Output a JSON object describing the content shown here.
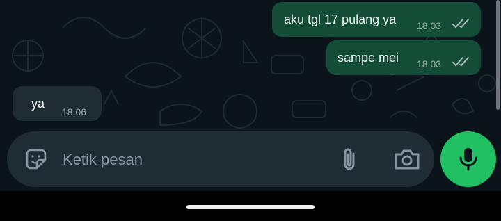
{
  "messages": [
    {
      "direction": "outgoing",
      "text": "aku tgl 17 pulang ya",
      "time": "18.03",
      "status": "read"
    },
    {
      "direction": "outgoing",
      "text": "sampe mei",
      "time": "18.03",
      "status": "read"
    },
    {
      "direction": "incoming",
      "text": "ya",
      "time": "18.06"
    }
  ],
  "composer": {
    "placeholder": "Ketik pesan",
    "value": ""
  },
  "icons": {
    "emoji": "sticker-icon",
    "attach": "paperclip-icon",
    "camera": "camera-icon",
    "mic": "microphone-icon",
    "ticks": "double-check-icon"
  },
  "colors": {
    "background": "#0b141a",
    "outgoing_bubble": "#134d37",
    "incoming_bubble": "#202c33",
    "composer": "#202c33",
    "mic_button": "#21c063"
  }
}
